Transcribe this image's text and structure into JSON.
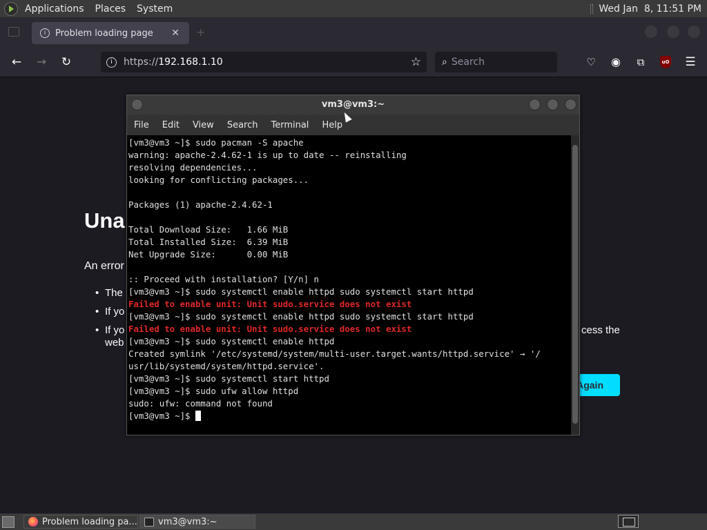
{
  "top_panel": {
    "menus": [
      "Applications",
      "Places",
      "System"
    ],
    "clock": "Wed Jan  8, 11:51 PM"
  },
  "browser": {
    "tab_title": "Problem loading page",
    "url_scheme": "https://",
    "url_host": "192.168.1.10",
    "search_placeholder": "Search",
    "page": {
      "title_fragment": "Una",
      "intro_fragment": "An error",
      "bullets": [
        "The",
        "If yo",
        "If yo"
      ],
      "bullet3_tail": "cess the",
      "bullet3_line2": "web",
      "try_again_fragment": "Again"
    }
  },
  "terminal": {
    "title": "vm3@vm3:~",
    "menus": [
      "File",
      "Edit",
      "View",
      "Search",
      "Terminal",
      "Help"
    ],
    "lines": [
      {
        "text": "[vm3@vm3 ~]$ sudo pacman -S apache",
        "error": false
      },
      {
        "text": "warning: apache-2.4.62-1 is up to date -- reinstalling",
        "error": false
      },
      {
        "text": "resolving dependencies...",
        "error": false
      },
      {
        "text": "looking for conflicting packages...",
        "error": false
      },
      {
        "text": "",
        "error": false
      },
      {
        "text": "Packages (1) apache-2.4.62-1",
        "error": false
      },
      {
        "text": "",
        "error": false
      },
      {
        "text": "Total Download Size:   1.66 MiB",
        "error": false
      },
      {
        "text": "Total Installed Size:  6.39 MiB",
        "error": false
      },
      {
        "text": "Net Upgrade Size:      0.00 MiB",
        "error": false
      },
      {
        "text": "",
        "error": false
      },
      {
        "text": ":: Proceed with installation? [Y/n] n",
        "error": false
      },
      {
        "text": "[vm3@vm3 ~]$ sudo systemctl enable httpd sudo systemctl start httpd",
        "error": false
      },
      {
        "text": "Failed to enable unit: Unit sudo.service does not exist",
        "error": true
      },
      {
        "text": "[vm3@vm3 ~]$ sudo systemctl enable httpd sudo systemctl start httpd",
        "error": false
      },
      {
        "text": "Failed to enable unit: Unit sudo.service does not exist",
        "error": true
      },
      {
        "text": "[vm3@vm3 ~]$ sudo systemctl enable httpd",
        "error": false
      },
      {
        "text": "Created symlink '/etc/systemd/system/multi-user.target.wants/httpd.service' → '/",
        "error": false
      },
      {
        "text": "usr/lib/systemd/system/httpd.service'.",
        "error": false
      },
      {
        "text": "[vm3@vm3 ~]$ sudo systemctl start httpd",
        "error": false
      },
      {
        "text": "[vm3@vm3 ~]$ sudo ufw allow httpd",
        "error": false
      },
      {
        "text": "sudo: ufw: command not found",
        "error": false
      }
    ],
    "prompt": "[vm3@vm3 ~]$ "
  },
  "taskbar": {
    "items": [
      {
        "label": "Problem loading pa...",
        "icon": "firefox-icon"
      },
      {
        "label": "vm3@vm3:~",
        "icon": "terminal-icon"
      }
    ]
  },
  "colors": {
    "error_red": "#e02828",
    "accent_cyan": "#00ddff",
    "page_bg": "#1c1b22"
  }
}
